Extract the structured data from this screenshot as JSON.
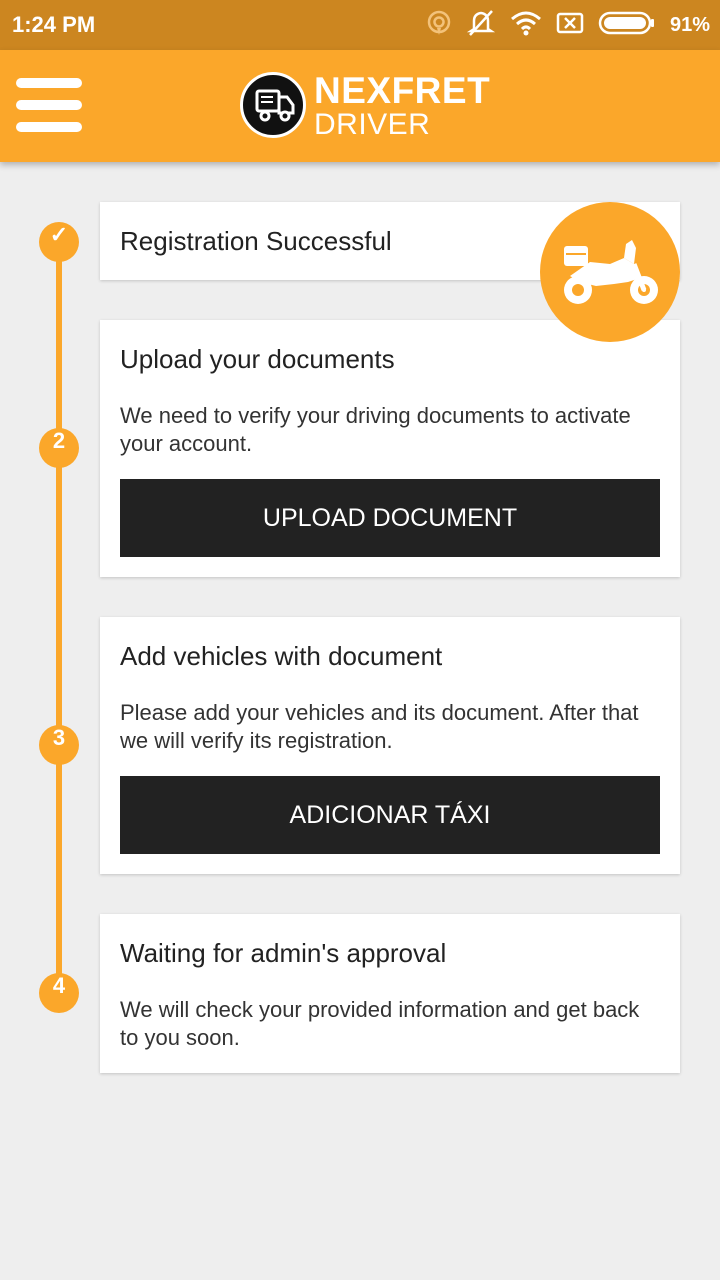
{
  "status_bar": {
    "time": "1:24 PM",
    "battery": "91%",
    "icons": [
      "hotspot-icon",
      "mute-icon",
      "wifi-icon",
      "sim-off-icon",
      "battery-icon"
    ]
  },
  "app_bar": {
    "brand_line1": "NEXFRET",
    "brand_line2": "DRIVER"
  },
  "steps": [
    {
      "marker": "✓",
      "title": "Registration Successful"
    },
    {
      "marker": "2",
      "title": "Upload your documents",
      "description": "We need to verify your driving documents to activate your account.",
      "button": "UPLOAD DOCUMENT"
    },
    {
      "marker": "3",
      "title": "Add vehicles with document",
      "description": "Please add your vehicles and its document. After that we will verify its registration.",
      "button": "ADICIONAR TÁXI"
    },
    {
      "marker": "4",
      "title": "Waiting for admin's approval",
      "description": "We will check your provided information and get back to you soon."
    }
  ],
  "colors": {
    "accent": "#fba72a",
    "status_bar": "#cc8620",
    "button": "#222222",
    "background": "#eeeeee"
  }
}
